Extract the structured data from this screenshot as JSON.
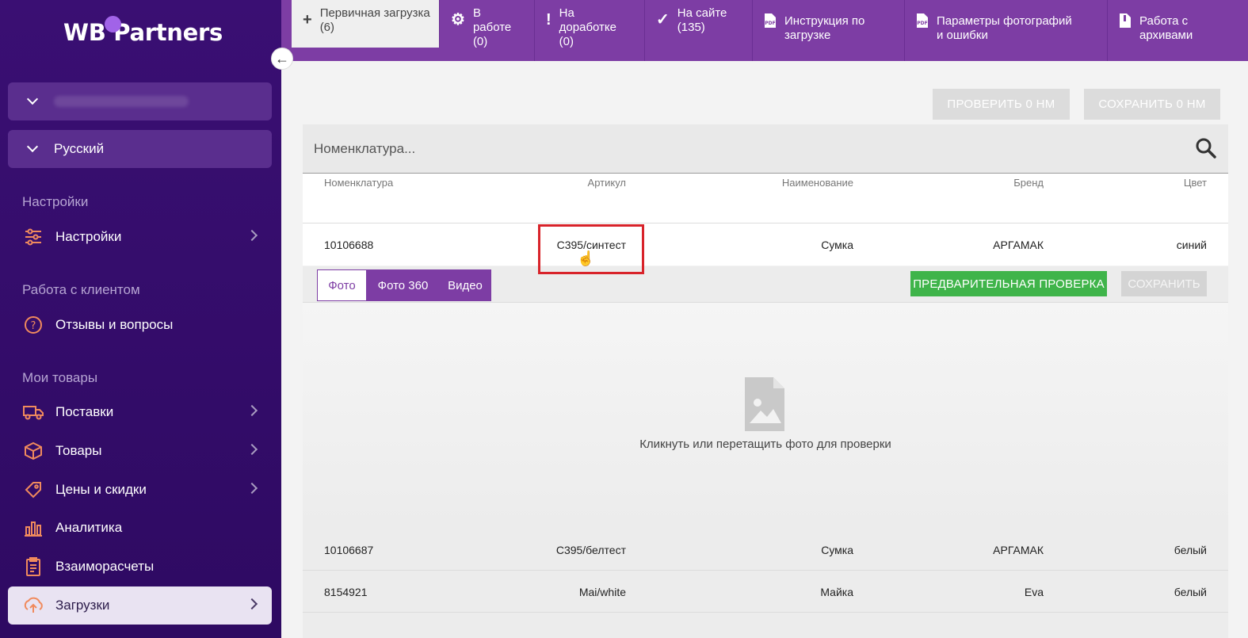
{
  "sidebar": {
    "logo": "WB Partners",
    "language": "Русский",
    "sections": [
      {
        "title": "Настройки",
        "items": [
          {
            "label": "Настройки",
            "icon": "sliders-icon",
            "arrow": true
          }
        ]
      },
      {
        "title": "Работа с клиентом",
        "items": [
          {
            "label": "Отзывы и вопросы",
            "icon": "question-icon",
            "arrow": false
          }
        ]
      },
      {
        "title": "Мои товары",
        "items": [
          {
            "label": "Поставки",
            "icon": "truck-icon",
            "arrow": true
          },
          {
            "label": "Товары",
            "icon": "box-icon",
            "arrow": true
          },
          {
            "label": "Цены и скидки",
            "icon": "tag-icon",
            "arrow": true
          },
          {
            "label": "Аналитика",
            "icon": "chart-icon",
            "arrow": false
          },
          {
            "label": "Взаиморасчеты",
            "icon": "clipboard-icon",
            "arrow": false
          },
          {
            "label": "Загрузки",
            "icon": "upload-icon",
            "arrow": true,
            "active": true
          }
        ]
      }
    ]
  },
  "tabs": [
    {
      "icon": "+",
      "label": "Первичная загрузка (6)"
    },
    {
      "icon": "⚙",
      "label": "В работе (0)"
    },
    {
      "icon": "!",
      "label": "На доработке (0)"
    },
    {
      "icon": "✓",
      "label": "На сайте (135)"
    },
    {
      "icon": "pdf",
      "label": "Инструкция по загрузке"
    },
    {
      "icon": "pdf",
      "label": "Параметры фотографий и ошибки"
    },
    {
      "icon": "zip",
      "label": "Работа с архивами"
    }
  ],
  "toolbar": {
    "check_label": "ПРОВЕРИТЬ 0 НМ",
    "save_label": "СОХРАНИТЬ 0 НМ"
  },
  "search": {
    "placeholder": "Номенклатура..."
  },
  "table": {
    "headers": [
      "Номенклатура",
      "Артикул",
      "Наименование",
      "Бренд",
      "Цвет"
    ],
    "rows": [
      [
        "10106688",
        "С395/синтест",
        "Сумка",
        "АРГАМАК",
        "синий"
      ],
      [
        "10106687",
        "С395/белтест",
        "Сумка",
        "АРГАМАК",
        "белый"
      ],
      [
        "8154921",
        "Mai/white",
        "Майка",
        "Eva",
        "белый"
      ]
    ]
  },
  "media_tabs": [
    "Фото",
    "Фото 360",
    "Видео"
  ],
  "actions": {
    "precheck_label": "ПРЕДВАРИТЕЛЬНАЯ ПРОВЕРКА",
    "save_label": "СОХРАНИТЬ"
  },
  "dropzone": {
    "text": "Кликнуть или перетащить фото для проверки"
  },
  "colors": {
    "sidebar": "#3a0f73",
    "accent": "#7d3da4",
    "icon": "#f08a5d",
    "green": "#3fb44a",
    "highlight": "#d8232a"
  }
}
